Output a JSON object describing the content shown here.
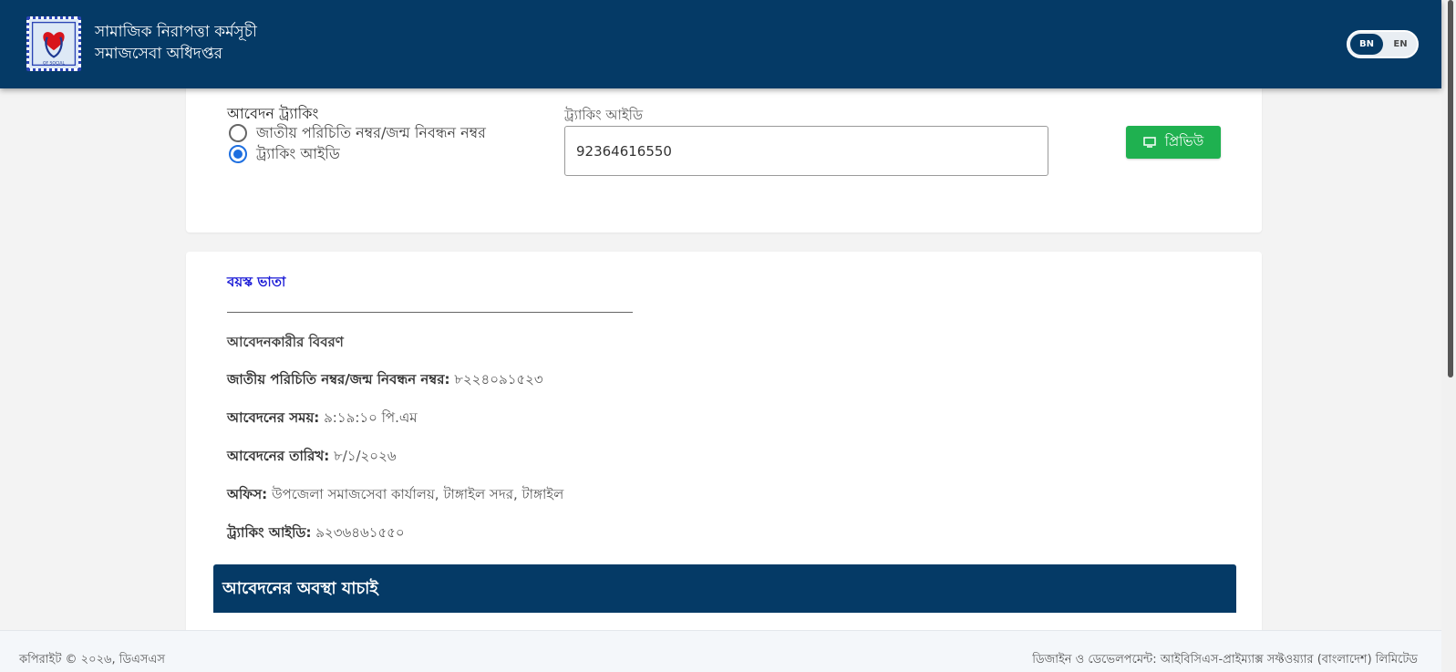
{
  "header": {
    "title": "সামাজিক নিরাপত্তা কর্মসূচী",
    "subtitle": "সমাজসেবা অধিদপ্তর",
    "lang_bn": "BN",
    "lang_en": "EN",
    "logo_text": "OF SOCIAL"
  },
  "search": {
    "section_title": "আবেদন ট্র্যাকিং",
    "options": [
      {
        "label": "জাতীয় পরিচিতি নম্বর/জন্ম নিবন্ধন নম্বর",
        "selected": false
      },
      {
        "label": "ট্র্যাকিং আইডি",
        "selected": true
      }
    ],
    "field_label": "ট্র্যাকিং আইডি",
    "field_value": "92364616550",
    "preview_label": "প্রিভিউ"
  },
  "result": {
    "program": "বয়স্ক ভাতা",
    "applicant_heading": "আবেদনকারীর বিবরণ",
    "rows": [
      {
        "label": "জাতীয় পরিচিতি নম্বর/জন্ম নিবন্ধন নম্বর:",
        "value": "৮২২৪০৯১৫২৩"
      },
      {
        "label": "আবেদনের সময়:",
        "value": "৯:১৯:১০ পি.এম"
      },
      {
        "label": "আবেদনের তারিখ:",
        "value": "৮/১/২০২৬"
      },
      {
        "label": "অফিস:",
        "value": "উপজেলা সমাজসেবা কার্যালয়, টাঙ্গাইল সদর, টাঙ্গাইল"
      },
      {
        "label": "ট্র্যাকিং আইডি:",
        "value": "৯২৩৬৪৬১৫৫০"
      }
    ],
    "status_heading": "আবেদনের অবস্থা যাচাই"
  },
  "footer": {
    "copyright": "কপিরাইট © ২০২৬, ডিএসএস",
    "credits": "ডিজাইন ও ডেভেলপমেন্ট: আইবিসিএস-প্রাইম্যাক্স সফ্টওয়্যার (বাংলাদেশ) লিমিটেড"
  },
  "colors": {
    "primary": "#053a66",
    "accent_green": "#1fb150",
    "radio_blue": "#1e6fe0",
    "program_blue": "#1a1ad6"
  }
}
